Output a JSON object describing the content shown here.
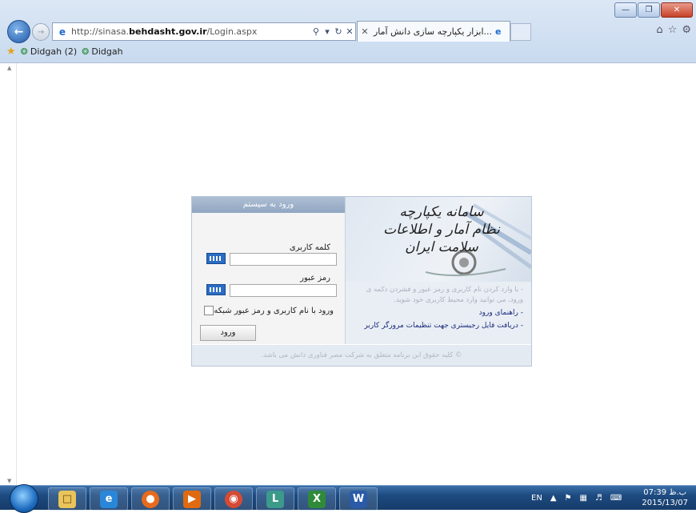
{
  "browser": {
    "address_url_prefix": "http://sinasa.",
    "address_url_domain": "behdasht.gov.ir",
    "address_url_suffix": "/Login.aspx",
    "tab_title": "...ابزار یکپارچه سازی دانش آمار",
    "favorites": [
      "Didgah (2)",
      "Didgah"
    ]
  },
  "login": {
    "header": "ورود به سیستم",
    "username_label": "کلمه کاربری",
    "password_label": "رمز عبور",
    "network_login_label": "ورود با نام کاربری و رمز عبور شبکه",
    "login_button": "ورود",
    "logo_line1": "سامانه یکپارچه",
    "logo_line2": "نظام آمار و اطلاعات",
    "logo_line3": "سلامت ایران",
    "info_text": "- با وارد کردن نام کاربری و رمز عبور و فشردن دکمه ی ورود، می توانید وارد محیط کاربری خود شوید.",
    "help_link": "- راهنمای ورود",
    "registry_link": "- دریافت فایل رجیستری جهت تنظیمات مرورگر کاربر",
    "footer": "© کلیه حقوق این برنامه متعلق به شرکت مصر فناوری دانش می باشد."
  },
  "taskbar": {
    "language": "EN",
    "clock_time": "07:39 ب.ظ",
    "clock_date": "2015/13/07"
  },
  "colors": {
    "login_header_bg": "#9fb3cc",
    "taskbar_bg": "#1d4a80"
  }
}
